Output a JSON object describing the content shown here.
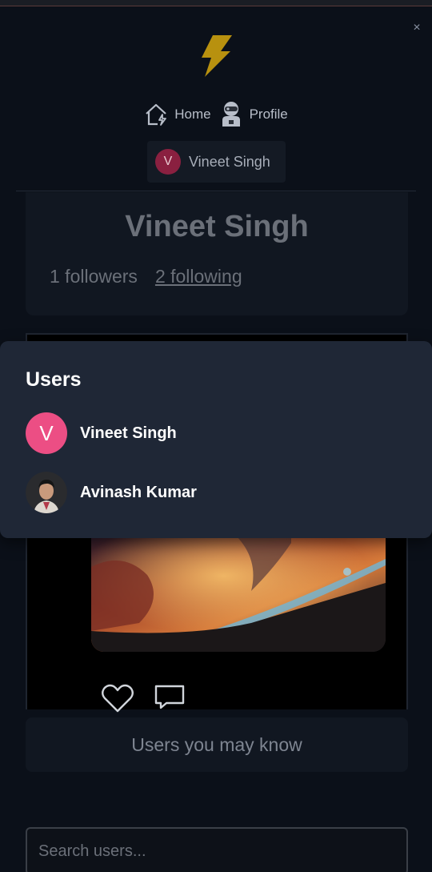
{
  "nav": {
    "home_label": "Home",
    "profile_label": "Profile",
    "close_label": "×"
  },
  "current_user": {
    "initial": "V",
    "name": "Vineet Singh"
  },
  "profile": {
    "name": "Vineet Singh",
    "followers": "1 followers",
    "following": "2 following"
  },
  "users_panel": {
    "title": "Users",
    "users": [
      {
        "initial": "V",
        "name": "Vineet Singh"
      },
      {
        "name": "Avinash Kumar"
      }
    ]
  },
  "suggestions": {
    "label": "Users you may know"
  },
  "search": {
    "placeholder": "Search users...",
    "value": ""
  },
  "colors": {
    "background": "#0b1019",
    "panel": "#1f2736",
    "accent_pink": "#ec4e84",
    "logo_gold": "#b8910f"
  }
}
